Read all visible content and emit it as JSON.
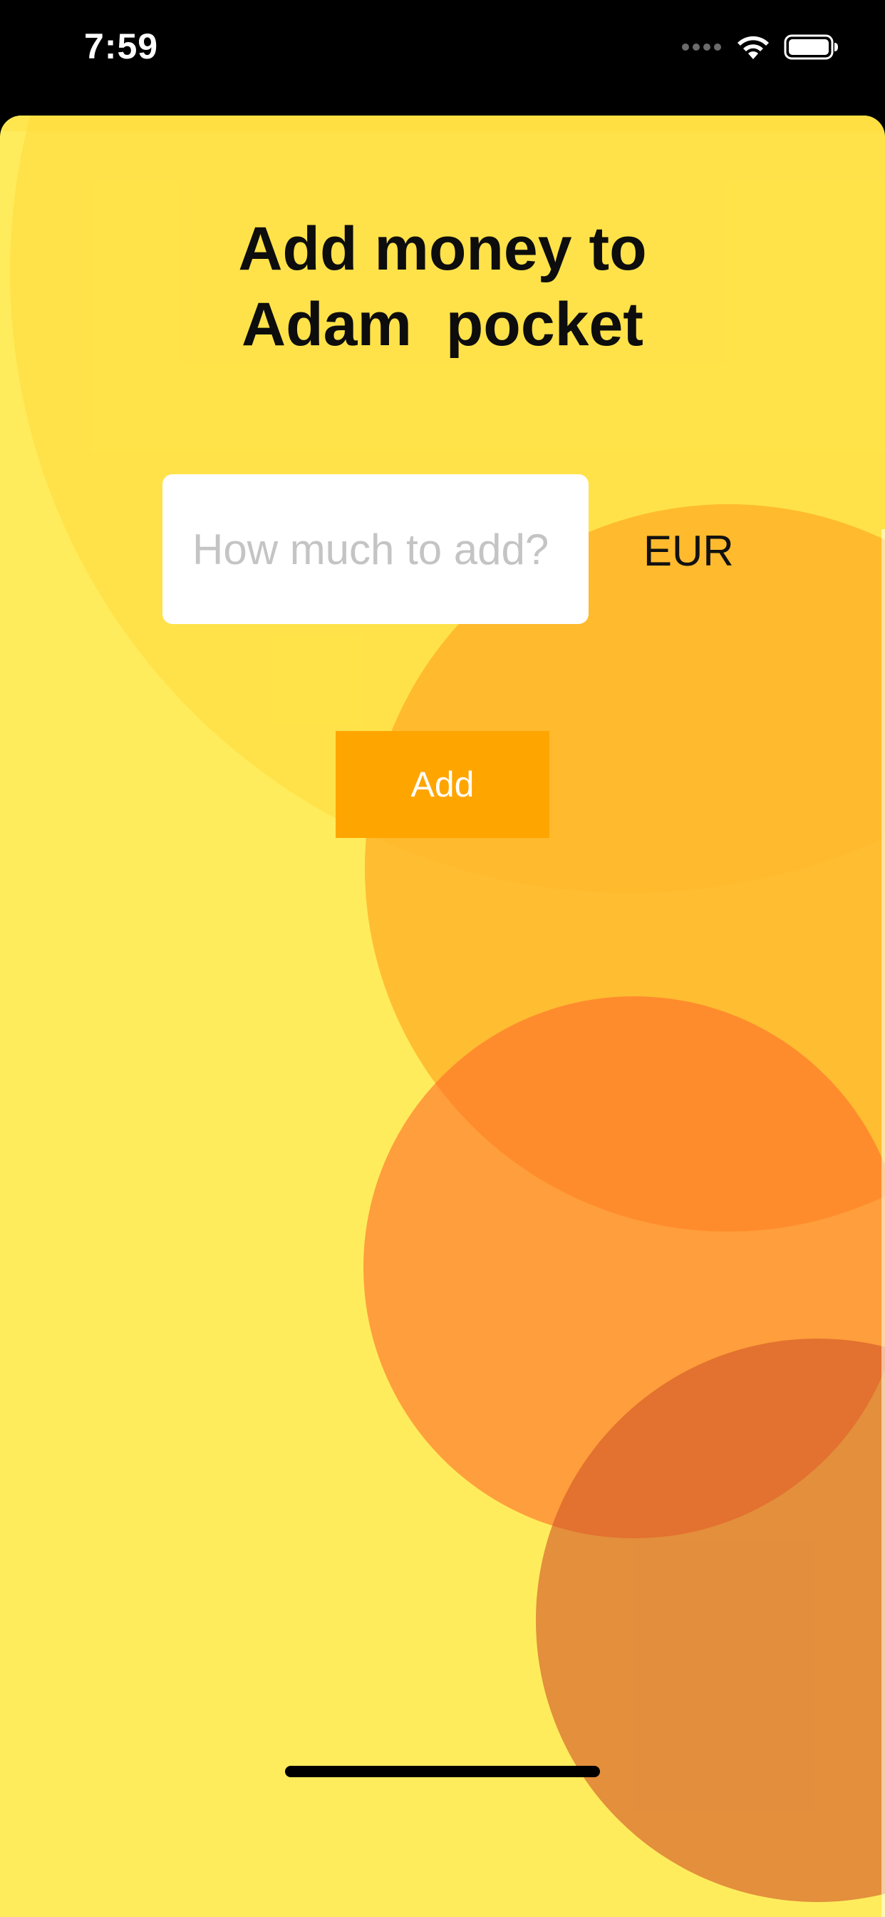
{
  "status_bar": {
    "time": "7:59",
    "icons": [
      "signal-dots-icon",
      "wifi-icon",
      "battery-icon"
    ]
  },
  "page": {
    "title": "Add money to\nAdam  pocket",
    "amount_input": {
      "value": "",
      "placeholder": "How much to add?"
    },
    "currency": "EUR",
    "add_button_label": "Add"
  },
  "colors": {
    "background": "#ffec5c",
    "accent": "#ffa500",
    "input_background": "#ffffff",
    "status_bar": "#000000"
  }
}
